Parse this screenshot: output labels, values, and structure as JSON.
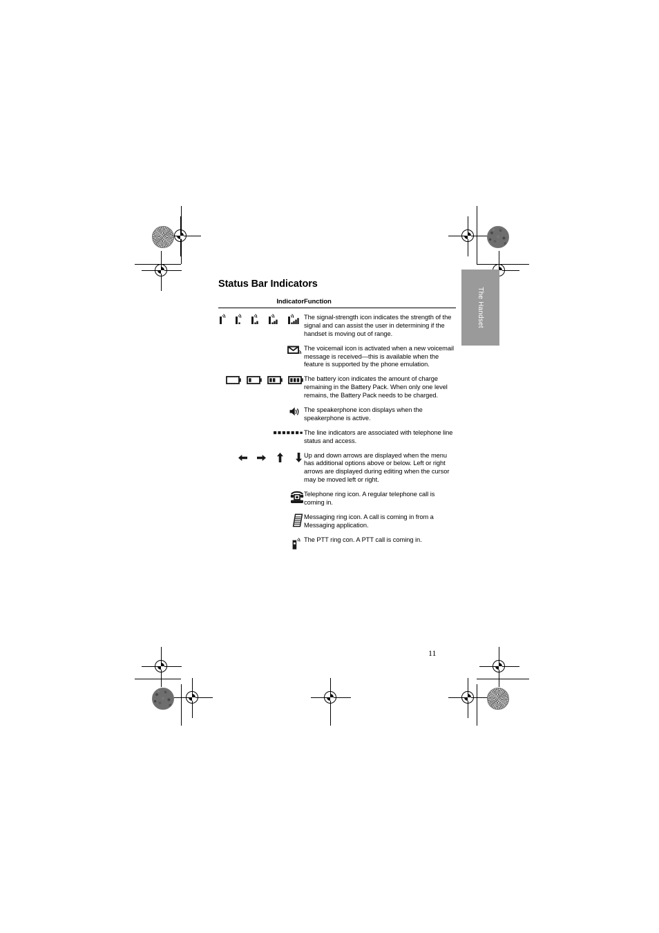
{
  "page": {
    "title": "Status Bar Indicators",
    "number": "11"
  },
  "side_tab": {
    "label": "The Handset"
  },
  "table": {
    "headers": {
      "indicator": "Indicator",
      "function": "Function"
    },
    "rows": [
      {
        "icon_name": "signal-strength-icons",
        "icon_count": 5,
        "function": "The signal-strength icon indicates the strength of the signal and can assist the user in determining if the handset is moving out of range."
      },
      {
        "icon_name": "voicemail-icon",
        "icon_count": 1,
        "function": "The voicemail icon is activated when a new voicemail message is received—this is available when the feature is supported by the phone emulation."
      },
      {
        "icon_name": "battery-icons",
        "icon_count": 4,
        "function": "The battery icon indicates the amount of charge remaining in the Battery Pack. When only one level remains, the Battery Pack needs to be charged."
      },
      {
        "icon_name": "speakerphone-icon",
        "icon_count": 1,
        "function": "The speakerphone icon displays when the speakerphone is active."
      },
      {
        "icon_name": "line-indicator-icon",
        "icon_count": 1,
        "function": "The line indicators are associated with telephone line status and access."
      },
      {
        "icon_name": "arrow-icons",
        "icon_count": 4,
        "function": "Up and down arrows are displayed when the menu has additional options above or below. Left or right arrows are displayed during editing when the cursor may be moved left or right."
      },
      {
        "icon_name": "telephone-ring-icon",
        "icon_count": 1,
        "function": "Telephone ring icon. A regular telephone call is coming in."
      },
      {
        "icon_name": "messaging-ring-icon",
        "icon_count": 1,
        "function": "Messaging ring icon. A call is coming in from a Messaging application."
      },
      {
        "icon_name": "ptt-ring-icon",
        "icon_count": 1,
        "function": "The PTT ring con. A PTT call is coming in."
      }
    ]
  },
  "colors": {
    "text": "#000000",
    "tab_background": "#9a9a9a",
    "tab_text": "#ffffff",
    "rule": "#000000"
  }
}
